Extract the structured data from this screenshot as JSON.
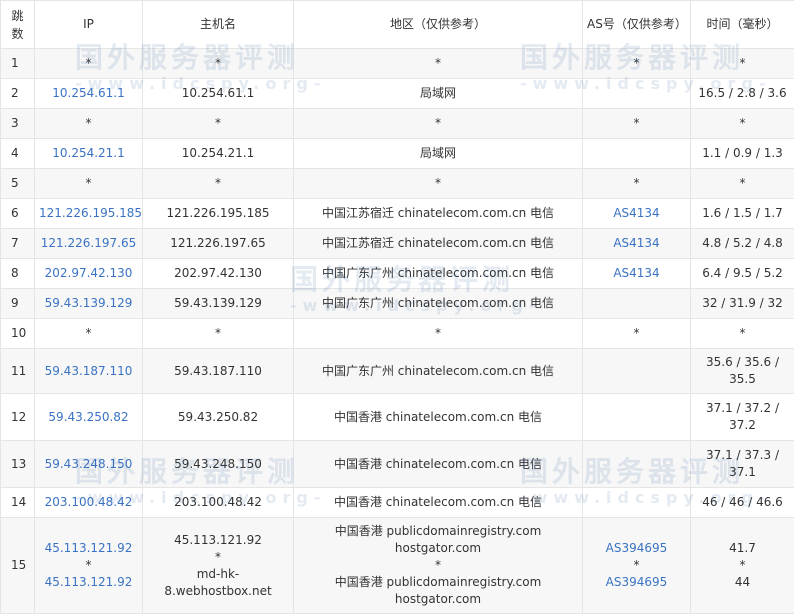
{
  "headers": {
    "hop": "跳数",
    "ip": "IP",
    "hostname": "主机名",
    "region": "地区（仅供参考）",
    "as": "AS号（仅供参考）",
    "time": "时间（毫秒）"
  },
  "rows": [
    {
      "hop": "1",
      "ip": [
        "*"
      ],
      "host": [
        "*"
      ],
      "region": [
        "*"
      ],
      "as": [
        "*"
      ],
      "time": [
        "*"
      ]
    },
    {
      "hop": "2",
      "ip": [
        "10.254.61.1"
      ],
      "host": [
        "10.254.61.1"
      ],
      "region": [
        "局域网"
      ],
      "as": [],
      "time": [
        "16.5 / 2.8 / 3.6"
      ]
    },
    {
      "hop": "3",
      "ip": [
        "*"
      ],
      "host": [
        "*"
      ],
      "region": [
        "*"
      ],
      "as": [
        "*"
      ],
      "time": [
        "*"
      ]
    },
    {
      "hop": "4",
      "ip": [
        "10.254.21.1"
      ],
      "host": [
        "10.254.21.1"
      ],
      "region": [
        "局域网"
      ],
      "as": [],
      "time": [
        "1.1 / 0.9 / 1.3"
      ]
    },
    {
      "hop": "5",
      "ip": [
        "*"
      ],
      "host": [
        "*"
      ],
      "region": [
        "*"
      ],
      "as": [
        "*"
      ],
      "time": [
        "*"
      ]
    },
    {
      "hop": "6",
      "ip": [
        "121.226.195.185"
      ],
      "host": [
        "121.226.195.185"
      ],
      "region": [
        "中国江苏宿迁 chinatelecom.com.cn 电信"
      ],
      "as": [
        "AS4134"
      ],
      "time": [
        "1.6 / 1.5 / 1.7"
      ]
    },
    {
      "hop": "7",
      "ip": [
        "121.226.197.65"
      ],
      "host": [
        "121.226.197.65"
      ],
      "region": [
        "中国江苏宿迁 chinatelecom.com.cn 电信"
      ],
      "as": [
        "AS4134"
      ],
      "time": [
        "4.8 / 5.2 / 4.8"
      ]
    },
    {
      "hop": "8",
      "ip": [
        "202.97.42.130"
      ],
      "host": [
        "202.97.42.130"
      ],
      "region": [
        "中国广东广州 chinatelecom.com.cn 电信"
      ],
      "as": [
        "AS4134"
      ],
      "time": [
        "6.4 / 9.5 / 5.2"
      ]
    },
    {
      "hop": "9",
      "ip": [
        "59.43.139.129"
      ],
      "host": [
        "59.43.139.129"
      ],
      "region": [
        "中国广东广州 chinatelecom.com.cn 电信"
      ],
      "as": [],
      "time": [
        "32 / 31.9 / 32"
      ]
    },
    {
      "hop": "10",
      "ip": [
        "*"
      ],
      "host": [
        "*"
      ],
      "region": [
        "*"
      ],
      "as": [
        "*"
      ],
      "time": [
        "*"
      ]
    },
    {
      "hop": "11",
      "ip": [
        "59.43.187.110"
      ],
      "host": [
        "59.43.187.110"
      ],
      "region": [
        "中国广东广州 chinatelecom.com.cn 电信"
      ],
      "as": [],
      "time": [
        "35.6 / 35.6 /",
        "35.5"
      ]
    },
    {
      "hop": "12",
      "ip": [
        "59.43.250.82"
      ],
      "host": [
        "59.43.250.82"
      ],
      "region": [
        "中国香港 chinatelecom.com.cn 电信"
      ],
      "as": [],
      "time": [
        "37.1 / 37.2 /",
        "37.2"
      ]
    },
    {
      "hop": "13",
      "ip": [
        "59.43.248.150"
      ],
      "host": [
        "59.43.248.150"
      ],
      "region": [
        "中国香港 chinatelecom.com.cn 电信"
      ],
      "as": [],
      "time": [
        "37.1 / 37.3 /",
        "37.1"
      ]
    },
    {
      "hop": "14",
      "ip": [
        "203.100.48.42"
      ],
      "host": [
        "203.100.48.42"
      ],
      "region": [
        "中国香港 chinatelecom.com.cn 电信"
      ],
      "as": [],
      "time": [
        "46 / 46 / 46.6"
      ]
    },
    {
      "hop": "15",
      "ip": [
        "45.113.121.92",
        "*",
        "45.113.121.92"
      ],
      "host": [
        "45.113.121.92",
        "*",
        "md-hk-",
        "8.webhostbox.net"
      ],
      "region": [
        "中国香港 publicdomainregistry.com",
        "hostgator.com",
        "*",
        "中国香港 publicdomainregistry.com",
        "hostgator.com"
      ],
      "as": [
        "AS394695",
        "*",
        "AS394695"
      ],
      "time": [
        "41.7",
        "*",
        "44"
      ]
    }
  ],
  "watermark": {
    "title": "国外服务器评测",
    "url": "-www.idcspy.org-"
  },
  "colors": {
    "link": "#3a73c4",
    "border": "#e5e5e5",
    "stripe": "#f7f7f7"
  }
}
